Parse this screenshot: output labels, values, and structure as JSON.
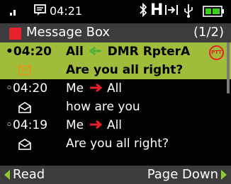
{
  "status": {
    "time": "04:21",
    "h_indicator": "H",
    "icons": [
      "signal-icon",
      "message-icon",
      "bluetooth-icon",
      "h-indicator",
      "arrow-bar-icon",
      "usb-icon",
      "battery-icon"
    ]
  },
  "title": {
    "text": "Message Box",
    "page": "(1/2)"
  },
  "messages": [
    {
      "time": "•04:20",
      "from": "All",
      "to": "DMR RpterA",
      "direction": "in",
      "body": "Are you all right?",
      "badge": "PTT",
      "selected": true,
      "read": false
    },
    {
      "time": "◦04:20",
      "from": "Me",
      "to": "All",
      "direction": "out",
      "body": "how are you",
      "selected": false,
      "read": true
    },
    {
      "time": "◦04:19",
      "from": "Me",
      "to": "All",
      "direction": "out",
      "body": "Are you all right?",
      "selected": false,
      "read": true
    }
  ],
  "softkeys": {
    "left": "Read",
    "right": "Page Down"
  },
  "colors": {
    "accent_green": "#9fbc3a",
    "bar_gray": "#3c3c3c",
    "red": "#e8212b",
    "arrow_green": "#8ccc33"
  }
}
